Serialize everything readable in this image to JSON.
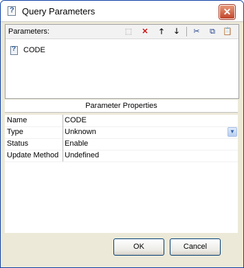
{
  "window": {
    "title": "Query Parameters",
    "close_glyph": "✕"
  },
  "toolbar": {
    "parameters_label": "Parameters:",
    "buttons": [
      {
        "name": "new-parameter-button",
        "icon": "new-icon",
        "glyph": "⬚",
        "color": "#8a8a8a"
      },
      {
        "name": "delete-parameter-button",
        "icon": "delete-x-icon",
        "glyph": "✕",
        "color": "#cc1111"
      },
      {
        "name": "move-up-button",
        "icon": "arrow-up-icon",
        "glyph": "🡑",
        "color": "#000000"
      },
      {
        "name": "move-down-button",
        "icon": "arrow-down-icon",
        "glyph": "🡓",
        "color": "#000000"
      },
      {
        "name": "cut-button",
        "icon": "scissors-icon",
        "glyph": "✂",
        "color": "#1d3d8a"
      },
      {
        "name": "copy-button",
        "icon": "copy-icon",
        "glyph": "⧉",
        "color": "#1d3d8a"
      },
      {
        "name": "paste-button",
        "icon": "paste-icon",
        "glyph": "📋",
        "color": "#8a6a1d"
      }
    ]
  },
  "parameters": [
    {
      "name": "CODE"
    }
  ],
  "properties": {
    "title": "Parameter Properties",
    "rows": [
      {
        "key": "Name",
        "value": "CODE"
      },
      {
        "key": "Type",
        "value": "Unknown",
        "dropdown": true
      },
      {
        "key": "Status",
        "value": "Enable"
      },
      {
        "key": "Update Method",
        "value": "Undefined"
      }
    ]
  },
  "buttons": {
    "ok": "OK",
    "cancel": "Cancel"
  }
}
